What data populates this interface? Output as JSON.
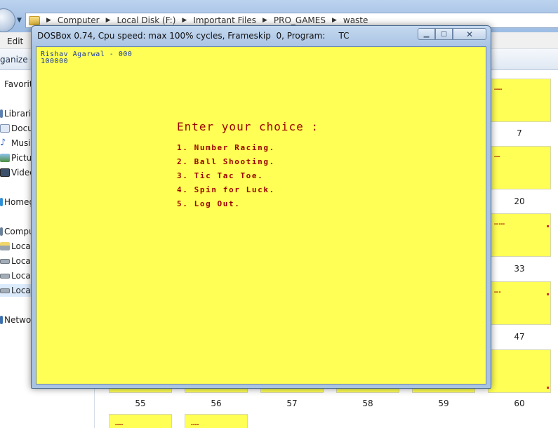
{
  "explorer": {
    "breadcrumbs": [
      "Computer",
      "Local Disk (F:)",
      "Important Files",
      "PRO_GAMES",
      "waste"
    ],
    "menu": {
      "edit": "Edit"
    },
    "toolbar": {
      "organize": "ganize"
    },
    "nav": {
      "favorites": "Favorit",
      "libraries": "Librari",
      "documents": "Docu",
      "music": "Musi",
      "pictures": "Pictu",
      "videos": "Video",
      "homegroup": "Homeg",
      "computer": "Compu",
      "local1": "Local",
      "local2": "Local",
      "local3": "Local",
      "local4": "Local",
      "network": "Netwo"
    },
    "thumb_labels": [
      "7",
      "20",
      "33",
      "47",
      "55",
      "56",
      "57",
      "58",
      "59",
      "60"
    ]
  },
  "dosbox": {
    "title": "DOSBox 0.74, Cpu speed: max 100% cycles, Frameskip  0, Program:     TC",
    "header_name": "Rishav Agarwal - 000",
    "header_score": "100000",
    "prompt": "Enter your choice :",
    "options": [
      "1. Number Racing.",
      "2. Ball Shooting.",
      "3. Tic Tac Toe.",
      "4. Spin for Luck.",
      "5. Log Out."
    ]
  },
  "colors": {
    "dos_background": "#ffff55",
    "menu_text": "#9a0000",
    "header_text": "#1a3aa8"
  }
}
